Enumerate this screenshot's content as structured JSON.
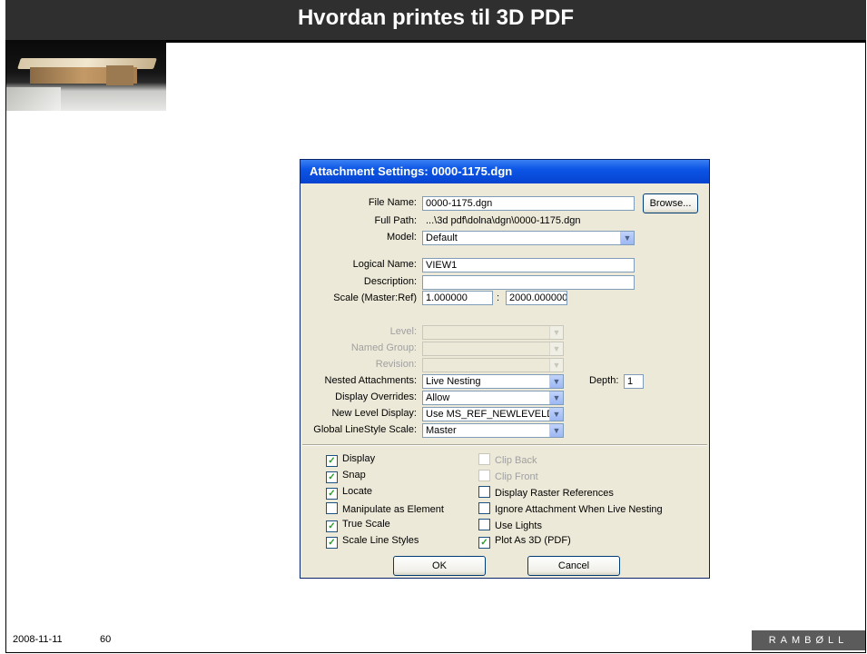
{
  "slide": {
    "title": "Hvordan printes til 3D PDF",
    "date": "2008-11-11",
    "page_number": "60",
    "logo_text": "RAMBØLL"
  },
  "dialog": {
    "title": "Attachment Settings: 0000-1175.dgn",
    "file_name_label": "File Name:",
    "file_name_value": "0000-1175.dgn",
    "browse_button": "Browse...",
    "full_path_label": "Full Path:",
    "full_path_value": "...\\3d pdf\\dolna\\dgn\\0000-1175.dgn",
    "model_label": "Model:",
    "model_value": "Default",
    "logical_name_label": "Logical Name:",
    "logical_name_value": "VIEW1",
    "description_label": "Description:",
    "description_value": "",
    "scale_label": "Scale (Master:Ref)",
    "scale_master": "1.000000",
    "scale_sep": ":",
    "scale_ref": "2000.000000",
    "level_label": "Level:",
    "named_group_label": "Named Group:",
    "revision_label": "Revision:",
    "nested_label": "Nested Attachments:",
    "nested_value": "Live Nesting",
    "depth_label": "Depth:",
    "depth_value": "1",
    "display_overrides_label": "Display Overrides:",
    "display_overrides_value": "Allow",
    "new_level_label": "New Level Display:",
    "new_level_value": "Use MS_REF_NEWLEVELDISPLAY",
    "linestyle_label": "Global LineStyle Scale:",
    "linestyle_value": "Master",
    "checkboxes_left": [
      {
        "label": "Display",
        "checked": true
      },
      {
        "label": "Snap",
        "checked": true
      },
      {
        "label": "Locate",
        "checked": true
      },
      {
        "label": "Manipulate as Element",
        "checked": false
      },
      {
        "label": "True Scale",
        "checked": true
      },
      {
        "label": "Scale Line Styles",
        "checked": true
      }
    ],
    "checkboxes_right": [
      {
        "label": "Clip Back",
        "checked": false,
        "disabled": true
      },
      {
        "label": "Clip Front",
        "checked": false,
        "disabled": true
      },
      {
        "label": "Display Raster References",
        "checked": false
      },
      {
        "label": "Ignore Attachment When Live Nesting",
        "checked": false
      },
      {
        "label": "Use Lights",
        "checked": false
      },
      {
        "label": "Plot As 3D (PDF)",
        "checked": true
      }
    ],
    "ok_button": "OK",
    "cancel_button": "Cancel"
  }
}
